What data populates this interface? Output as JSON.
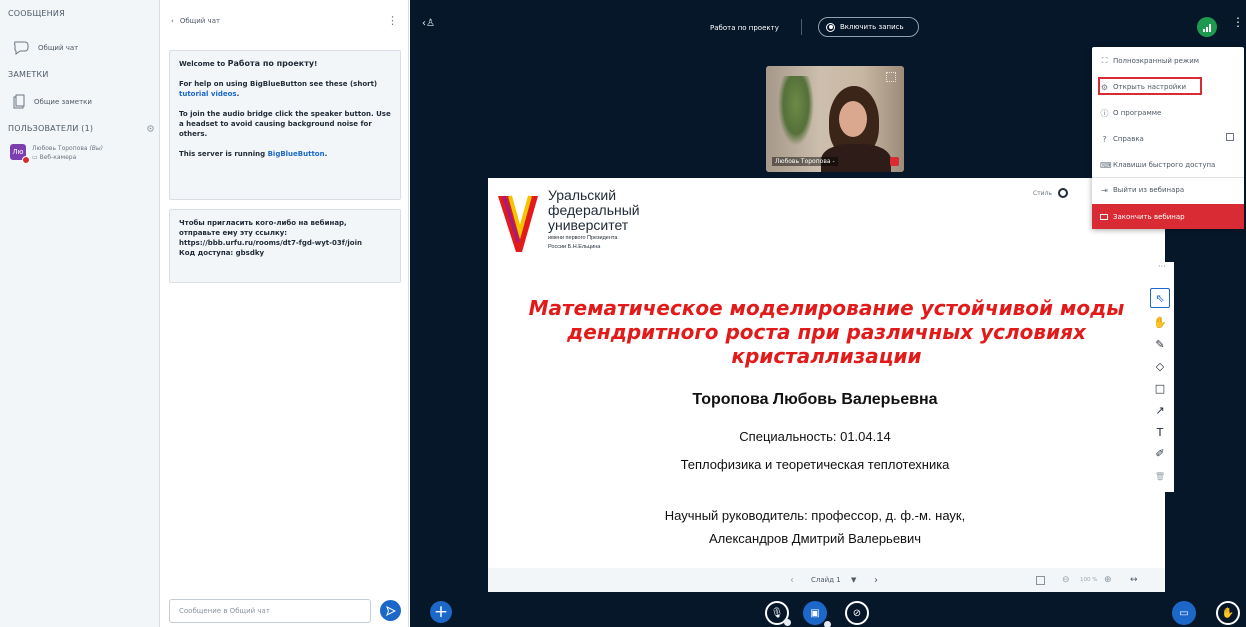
{
  "sidebar": {
    "messages_title": "СООБЩЕНИЯ",
    "public_chat": "Общий чат",
    "notes_title": "ЗАМЕТКИ",
    "shared_notes": "Общие заметки",
    "users_title": "ПОЛЬЗОВАТЕЛИ (1)",
    "user": {
      "avatar": "Лю",
      "name": "Любовь Торопова",
      "you": "(Вы)",
      "status": "Веб-камера"
    }
  },
  "chat": {
    "header": "Общий чат",
    "welcome_prefix": "Welcome to ",
    "welcome_room": "Работа по проекту",
    "welcome_suffix": "!",
    "help_text": "For help on using BigBlueButton see these (short)",
    "help_link": "tutorial videos",
    "audio_text": "To join the audio bridge click the speaker button. Use a headset to avoid causing background noise for others.",
    "server_prefix": "This server is running ",
    "server_link": "BigBlueButton",
    "invite_line1": "Чтобы пригласить кого-либо на вебинар,",
    "invite_line2": "отправьте ему эту ссылку:",
    "invite_link": "https://bbb.urfu.ru/rooms/dt7-fgd-wyt-03f/join",
    "invite_code": "Код доступа: gbsdky",
    "input_placeholder": "Сообщение в Общий чат"
  },
  "topbar": {
    "title": "Работа по проекту",
    "record": "Включить запись"
  },
  "webcam": {
    "name": "Любовь Торопова -"
  },
  "slide": {
    "uni_line1": "Уральский",
    "uni_line2": "федеральный",
    "uni_line3": "университет",
    "uni_sub1": "имени первого Президента",
    "uni_sub2": "России Б.Н.Ельцина",
    "title": "Математическое моделирование устойчивой моды дендритного роста при различных условиях кристаллизации",
    "author": "Торопова Любовь Валерьевна",
    "specialty": "Специальность: 01.04.14",
    "specialty_name": "Теплофизика и теоретическая теплотехника",
    "supervisor_line1": "Научный руководитель: профессор, д. ф.-м. наук,",
    "supervisor_line2": "Александров Дмитрий Валерьевич",
    "style_label": "Стиль"
  },
  "slide_bar": {
    "slide_label": "Слайд 1",
    "zoom": "100 %"
  },
  "menu": {
    "fullscreen": "Полноэкранный режим",
    "settings": "Открыть настройки",
    "about": "О программе",
    "help": "Справка",
    "shortcuts": "Клавиши быстрого доступа",
    "leave": "Выйти из вебинара",
    "end": "Закончить вебинар"
  },
  "colors": {
    "accent": "#1b68c9",
    "danger": "#d92b34",
    "main_bg": "#06172a",
    "slide_title": "#e21a1a"
  }
}
